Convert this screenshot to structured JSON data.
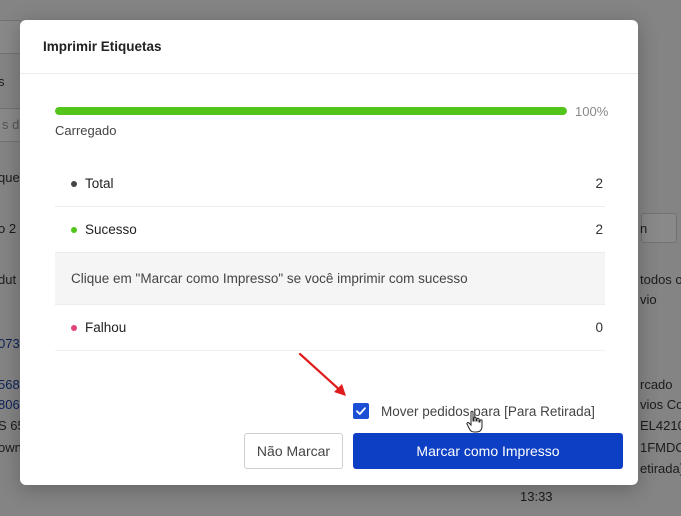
{
  "background": {
    "fragments": [
      {
        "text": "s",
        "link": false
      },
      {
        "text": "s de",
        "link": false
      },
      {
        "text": "que",
        "link": false
      },
      {
        "text": "o 2",
        "link": false
      },
      {
        "text": "dut",
        "link": false
      },
      {
        "text": "073",
        "link": true
      },
      {
        "text": "568",
        "link": true
      },
      {
        "text": "806",
        "link": true
      },
      {
        "text": "S 65",
        "link": false
      },
      {
        "text": "own",
        "link": false
      },
      {
        "text": "n",
        "link": false
      },
      {
        "text": "todos o",
        "link": false
      },
      {
        "text": "vio",
        "link": false
      },
      {
        "text": "rcado",
        "link": false
      },
      {
        "text": "vios Co",
        "link": false
      },
      {
        "text": "EL4210",
        "link": false
      },
      {
        "text": "1FMDO",
        "link": false
      },
      {
        "text": "etirada]",
        "link": false
      },
      {
        "text": "13:33",
        "link": false
      }
    ]
  },
  "modal": {
    "title": "Imprimir Etiquetas",
    "progress_percent": 100,
    "progress_label": "100%",
    "status_label": "Carregado",
    "rows": {
      "total": {
        "label": "Total",
        "value": "2",
        "dot_color": "#444444"
      },
      "success": {
        "label": "Sucesso",
        "value": "2",
        "dot_color": "#52c41a"
      },
      "notice": "Clique em \"Marcar como Impresso\" se você imprimir com sucesso",
      "failed": {
        "label": "Falhou",
        "value": "0",
        "dot_color": "#e0457b"
      }
    },
    "checkbox": {
      "label": "Mover pedidos para [Para Retirada]",
      "checked": true
    },
    "buttons": {
      "secondary": "Não Marcar",
      "primary": "Marcar como Impresso"
    }
  },
  "colors": {
    "accent": "#0d3fc4",
    "progress": "#52c41a",
    "annotation_arrow": "#e01b1b"
  }
}
